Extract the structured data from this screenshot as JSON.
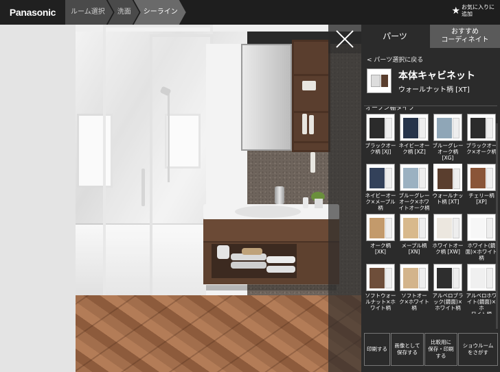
{
  "header": {
    "logo": "Panasonic",
    "breadcrumbs": [
      "ルーム選択",
      "洗面",
      "シーライン"
    ],
    "favorite_label": "お気に入りに追加"
  },
  "panel": {
    "close_glyph": "×",
    "tab_parts": "パーツ",
    "tab_recommend_line1": "おすすめ",
    "tab_recommend_line2": "コーディネイト",
    "back_link": "< パーツ選択に戻る",
    "part_title": "本体キャビネット",
    "part_subtitle": "ウォールナット柄 [XT]",
    "section_heading": "オープン棚タイプ",
    "swatches": [
      {
        "line1": "ブラックオー",
        "line2": "ク柄 [XJ]",
        "line3": "",
        "color": "#2b2b2b",
        "selected": false
      },
      {
        "line1": "ネイビーオー",
        "line2": "ク柄 [XZ]",
        "line3": "",
        "color": "#26344a",
        "selected": false
      },
      {
        "line1": "ブルーグレー",
        "line2": "オーク柄 [XG]",
        "line3": "",
        "color": "#8fa6b7",
        "selected": false
      },
      {
        "line1": "ブラックオー",
        "line2": "ク×オーク柄",
        "line3": "",
        "color": "#2b2b2b",
        "selected": false
      },
      {
        "line1": "ネイビーオー",
        "line2": "ク×メープル",
        "line3": "柄",
        "color": "#33415a",
        "selected": false
      },
      {
        "line1": "ブルーグレー",
        "line2": "オーク×ホワ",
        "line3": "イトオーク柄",
        "color": "#9bb1c1",
        "selected": false
      },
      {
        "line1": "ウォールナッ",
        "line2": "ト柄 [XT]",
        "line3": "",
        "color": "#5a3e2e",
        "selected": true
      },
      {
        "line1": "チェリー柄",
        "line2": "[XP]",
        "line3": "",
        "color": "#8a5538",
        "selected": false
      },
      {
        "line1": "オーク柄 [XK]",
        "line2": "",
        "line3": "",
        "color": "#c39a6b",
        "selected": false
      },
      {
        "line1": "メープル柄",
        "line2": "[XN]",
        "line3": "",
        "color": "#d8b98c",
        "selected": false
      },
      {
        "line1": "ホワイトオー",
        "line2": "ク柄 [XW]",
        "line3": "",
        "color": "#ece7df",
        "selected": false
      },
      {
        "line1": "ホワイト(鏡",
        "line2": "面)×ホワイト",
        "line3": "柄",
        "color": "#f7f7f7",
        "selected": false
      },
      {
        "line1": "ソフトウォー",
        "line2": "ルナット×ホ",
        "line3": "ワイト柄",
        "color": "#6e4e3a",
        "selected": false
      },
      {
        "line1": "ソフトオー",
        "line2": "ク×ホワイト柄",
        "line3": "",
        "color": "#d3b48b",
        "selected": false
      },
      {
        "line1": "アルベロブラ",
        "line2": "ック(鏡面)×",
        "line3": "ホワイト柄",
        "color": "#2e2e2e",
        "selected": false
      },
      {
        "line1": "アルベロホワ",
        "line2": "イト(鏡面)×ホ",
        "line3": "ワイト柄",
        "color": "#f0f0f0",
        "selected": false
      },
      {
        "line1": "",
        "line2": "",
        "line3": "",
        "color": "#f2f2f2",
        "selected": false
      }
    ],
    "actions": [
      {
        "line1": "印刷する",
        "line2": ""
      },
      {
        "line1": "画像として",
        "line2": "保存する"
      },
      {
        "line1": "比較用に",
        "line2": "保存・印刷する"
      },
      {
        "line1": "ショウルーム",
        "line2": "をさがす"
      }
    ]
  }
}
